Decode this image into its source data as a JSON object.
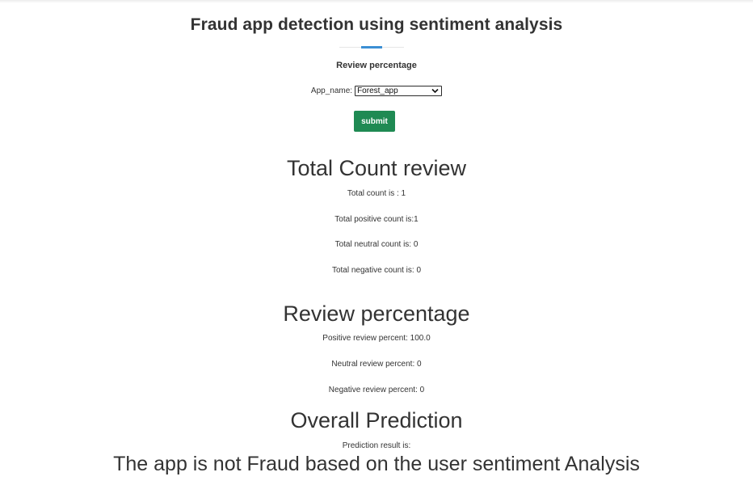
{
  "header": {
    "title": "Fraud app detection using sentiment analysis",
    "subtitle": "Review percentage"
  },
  "form": {
    "app_label": "App_name:",
    "app_selected": "Forest_app",
    "submit_label": "submit"
  },
  "total_count": {
    "heading": "Total Count review",
    "total": "Total count is : 1",
    "positive": "Total positive count is:1",
    "neutral": "Total neutral count is: 0",
    "negative": "Total negative count is: 0"
  },
  "review_percentage": {
    "heading": "Review percentage",
    "positive": "Positive review percent: 100.0",
    "neutral": "Neutral review percent: 0",
    "negative": "Negative review percent: 0"
  },
  "prediction": {
    "heading": "Overall Prediction",
    "label": "Prediction result is:",
    "result": "The app is not Fraud based on the user sentiment Analysis"
  },
  "colors": {
    "submit_button": "#1f8a53",
    "divider_accent": "#3b8fd4",
    "text": "#333333"
  }
}
